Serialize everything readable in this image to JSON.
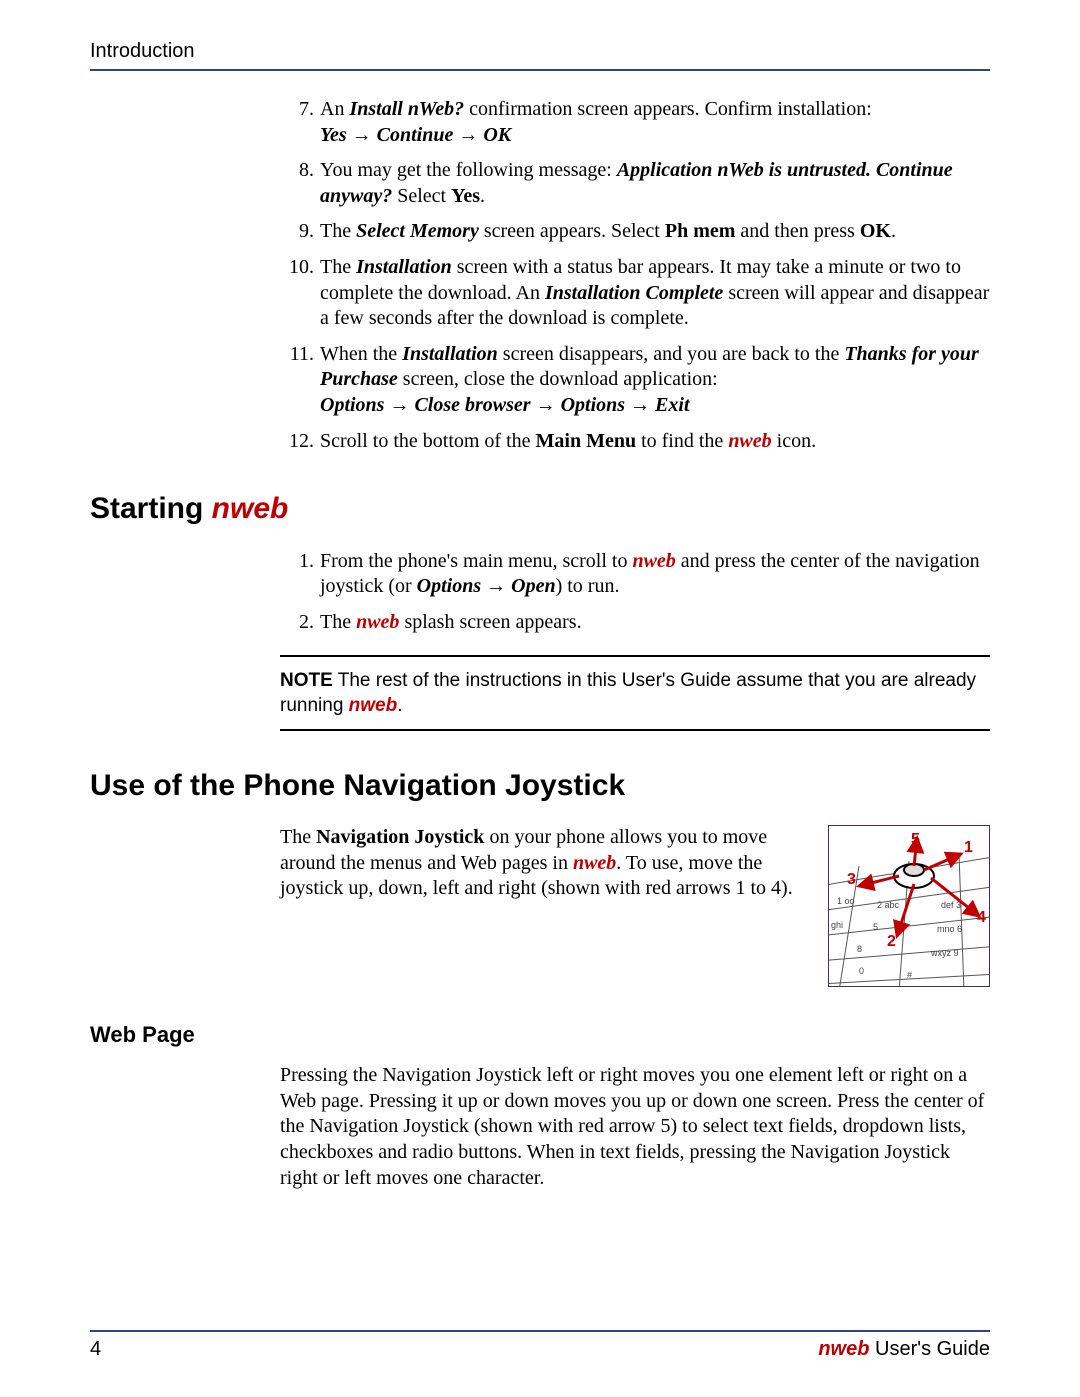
{
  "header": {
    "title": "Introduction"
  },
  "install_steps": [
    {
      "n": "7.",
      "parts": [
        {
          "t": "An "
        },
        {
          "t": "Install nWeb?",
          "cls": "bi"
        },
        {
          "t": " confirmation screen appears. Confirm installation: "
        },
        {
          "br": true
        },
        {
          "t": "Yes → Continue → OK",
          "cls": "bi"
        }
      ]
    },
    {
      "n": "8.",
      "parts": [
        {
          "t": "You may get the following message: "
        },
        {
          "t": "Application nWeb is untrusted. Continue anyway?",
          "cls": "bi"
        },
        {
          "t": " Select "
        },
        {
          "t": "Yes",
          "cls": "b"
        },
        {
          "t": "."
        }
      ]
    },
    {
      "n": "9.",
      "parts": [
        {
          "t": "The "
        },
        {
          "t": "Select Memory",
          "cls": "bi"
        },
        {
          "t": " screen appears. Select "
        },
        {
          "t": "Ph mem",
          "cls": "b"
        },
        {
          "t": " and then press "
        },
        {
          "t": "OK",
          "cls": "b"
        },
        {
          "t": "."
        }
      ]
    },
    {
      "n": "10.",
      "parts": [
        {
          "t": "The "
        },
        {
          "t": "Installation",
          "cls": "bi"
        },
        {
          "t": " screen with a status bar appears. It may take a minute or two to complete the download. An "
        },
        {
          "t": "Installation Complete",
          "cls": "bi"
        },
        {
          "t": " screen will appear and disappear a few seconds after the download is complete."
        }
      ]
    },
    {
      "n": "11.",
      "parts": [
        {
          "t": "When the "
        },
        {
          "t": "Installation",
          "cls": "bi"
        },
        {
          "t": " screen disappears, and you are back to the "
        },
        {
          "t": "Thanks for your Purchase",
          "cls": "bi"
        },
        {
          "t": " screen, close the download application:"
        },
        {
          "br": true
        },
        {
          "t": "Options → Close browser → Options → Exit",
          "cls": "bi"
        }
      ]
    },
    {
      "n": "12.",
      "parts": [
        {
          "t": "Scroll to the bottom of the "
        },
        {
          "t": "Main Menu",
          "cls": "b"
        },
        {
          "t": " to find the "
        },
        {
          "t": "nweb",
          "cls": "nweb-red"
        },
        {
          "t": " icon."
        }
      ]
    }
  ],
  "section_start": {
    "prefix": "Starting ",
    "brand": "nweb"
  },
  "start_steps": [
    {
      "n": "1.",
      "parts": [
        {
          "t": "From the phone's main menu, scroll to "
        },
        {
          "t": "nweb",
          "cls": "nweb-red"
        },
        {
          "t": " and press the center of the navigation joystick (or "
        },
        {
          "t": "Options → Open",
          "cls": "bi"
        },
        {
          "t": ") to run."
        }
      ]
    },
    {
      "n": "2.",
      "parts": [
        {
          "t": "The "
        },
        {
          "t": "nweb",
          "cls": "nweb-red"
        },
        {
          "t": " splash screen appears."
        }
      ]
    }
  ],
  "note": {
    "label": "NOTE",
    "before": "  The rest of the instructions in this User's Guide assume that you are already running ",
    "brand": "nweb",
    "after": "."
  },
  "section_nav": "Use of the Phone Navigation Joystick",
  "nav_para_parts": [
    {
      "t": "The "
    },
    {
      "t": "Navigation Joystick",
      "cls": "b"
    },
    {
      "t": " on your phone allows you to move around the menus and Web pages in "
    },
    {
      "t": "nweb",
      "cls": "nweb-red"
    },
    {
      "t": ". To use, move the joystick up, down, left and right (shown with red arrows 1 to 4)."
    }
  ],
  "diagram": {
    "labels": [
      "1",
      "2",
      "3",
      "4",
      "5"
    ],
    "keys": [
      "1 oo",
      "2 abc",
      "def 3",
      "ghi",
      "5",
      "mno 6",
      "8",
      "wxyz 9",
      "0",
      "#"
    ]
  },
  "subsection": "Web Page",
  "webpage_para": "Pressing the Navigation Joystick left or right moves you one element left or right on a Web page. Pressing it up or down moves you up or down one screen. Press the center of the Navigation Joystick (shown with red arrow 5) to select text fields, dropdown lists, checkboxes and radio buttons. When in text fields, pressing the Navigation Joystick right or left moves one character.",
  "footer": {
    "page": "4",
    "brand": "nweb",
    "suffix": " User's Guide"
  }
}
